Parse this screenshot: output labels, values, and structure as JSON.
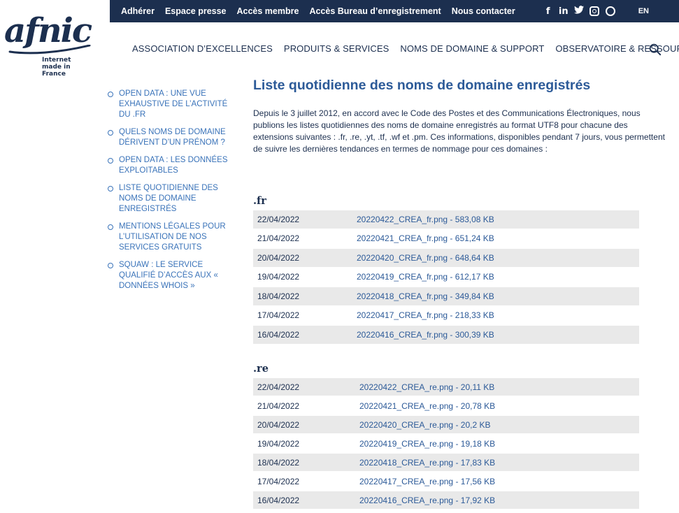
{
  "brand": {
    "logo_text": "afnic",
    "tagline_line1": "Internet",
    "tagline_line2": "made in France"
  },
  "topbar": {
    "links": [
      "Adhérer",
      "Espace presse",
      "Accès membre",
      "Accès Bureau d’enregistrement",
      "Nous contacter"
    ],
    "social": {
      "facebook": "f",
      "linkedin": "in",
      "twitter": "🐦"
    },
    "lang": "EN"
  },
  "nav": {
    "items": [
      "ASSOCIATION D’EXCELLENCES",
      "PRODUITS & SERVICES",
      "NOMS DE DOMAINE & SUPPORT",
      "OBSERVATOIRE & RESSOURCES"
    ]
  },
  "sidebar": {
    "items": [
      "OPEN DATA : UNE VUE EXHAUSTIVE DE L’ACTIVITÉ DU .FR",
      "QUELS NOMS DE DOMAINE DÉRIVENT D’UN PRÉNOM ?",
      "OPEN DATA : LES DONNÉES EXPLOITABLES",
      "LISTE QUOTIDIENNE DES NOMS DE DOMAINE ENREGISTRÉS",
      "MENTIONS LÉGALES POUR L’UTILISATION DE NOS SERVICES GRATUITS",
      "SQUAW : LE SERVICE QUALIFIÉ D’ACCÈS AUX « DONNÉES WHOIS »"
    ]
  },
  "main": {
    "title": "Liste quotidienne des noms de domaine enregistrés",
    "intro": "Depuis le 3 juillet 2012, en accord avec le Code des Postes et des Communications Électroniques, nous publions les listes quotidiennes des noms de domaine enregistrés au format UTF8 pour chacune des extensions suivantes : .fr, .re, .yt, .tf, .wf et .pm. Ces informations, disponibles pendant 7 jours, vous permettent de suivre les dernières tendances en termes de nommage pour ces domaines :"
  },
  "sections": [
    {
      "title": ".fr",
      "rows": [
        {
          "date": "22/04/2022",
          "file": "20220422_CREA_fr.png - 583,08 KB"
        },
        {
          "date": "21/04/2022",
          "file": "20220421_CREA_fr.png - 651,24 KB"
        },
        {
          "date": "20/04/2022",
          "file": "20220420_CREA_fr.png - 648,64 KB"
        },
        {
          "date": "19/04/2022",
          "file": "20220419_CREA_fr.png - 612,17 KB"
        },
        {
          "date": "18/04/2022",
          "file": "20220418_CREA_fr.png - 349,84 KB"
        },
        {
          "date": "17/04/2022",
          "file": "20220417_CREA_fr.png - 218,33 KB"
        },
        {
          "date": "16/04/2022",
          "file": "20220416_CREA_fr.png - 300,39 KB"
        }
      ]
    },
    {
      "title": ".re",
      "rows": [
        {
          "date": "22/04/2022",
          "file": "20220422_CREA_re.png - 20,11 KB"
        },
        {
          "date": "21/04/2022",
          "file": "20220421_CREA_re.png - 20,78 KB"
        },
        {
          "date": "20/04/2022",
          "file": "20220420_CREA_re.png - 20,2 KB"
        },
        {
          "date": "19/04/2022",
          "file": "20220419_CREA_re.png - 19,18 KB"
        },
        {
          "date": "18/04/2022",
          "file": "20220418_CREA_re.png - 17,83 KB"
        },
        {
          "date": "17/04/2022",
          "file": "20220417_CREA_re.png - 17,56 KB"
        },
        {
          "date": "16/04/2022",
          "file": "20220416_CREA_re.png - 17,92 KB"
        }
      ]
    }
  ],
  "colors": {
    "navy": "#1c2f4f",
    "link_blue": "#3a73b9",
    "title_blue": "#2c5a98",
    "row_gray": "#e9e9e9"
  },
  "icons": {
    "search": "search-icon",
    "facebook": "facebook-icon",
    "linkedin": "linkedin-icon",
    "twitter": "twitter-icon",
    "instagram": "instagram-icon",
    "pinterest": "pinterest-icon"
  }
}
